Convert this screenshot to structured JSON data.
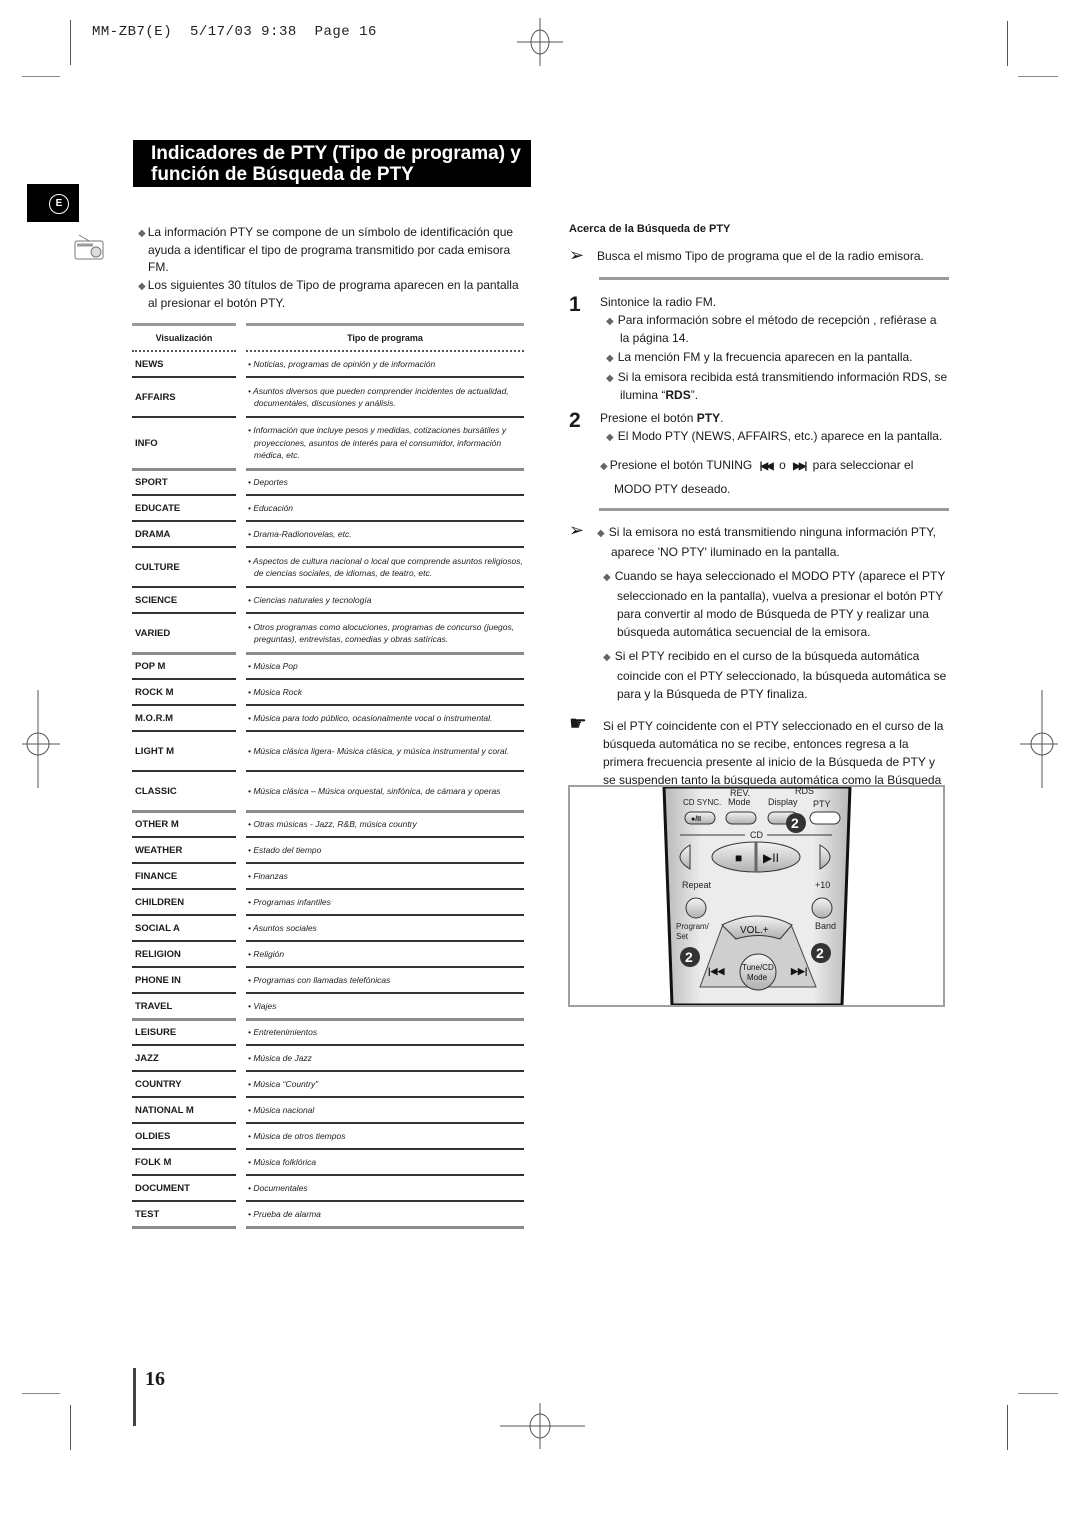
{
  "slug": {
    "code": "MM-ZB7(E)",
    "date": "5/17/03",
    "time": "9:38",
    "page_label": "Page",
    "page": "16"
  },
  "section_title": {
    "line1": "Indicadores de PTY (Tipo de programa) y",
    "line2": "función de Búsqueda de PTY"
  },
  "language_badge": "E",
  "intro": [
    "La información PTY se compone de un símbolo de identificación que ayuda a identificar el tipo de programa transmitido por cada emisora FM.",
    "Los siguientes 30 títulos de Tipo de programa aparecen en la pantalla al presionar el botón PTY."
  ],
  "pty_table": {
    "headers": [
      "Visualización",
      "Tipo de programa"
    ],
    "rows": [
      {
        "code": "NEWS",
        "desc": "• Noticias, programas de opinión y de información"
      },
      {
        "code": "AFFAIRS",
        "desc": "• Asuntos diversos que pueden comprender incidentes de actualidad, documentales, discusiones y análisis."
      },
      {
        "code": "INFO",
        "desc": "• Información que incluye pesos y medidas, cotizaciones bursátiles y proyecciones, asuntos de interés para el consumidor, información médica, etc."
      },
      {
        "code": "SPORT",
        "desc": "• Deportes"
      },
      {
        "code": "EDUCATE",
        "desc": "• Educación"
      },
      {
        "code": "DRAMA",
        "desc": "• Drama-Radionovelas, etc."
      },
      {
        "code": "CULTURE",
        "desc": "• Aspectos de cultura nacional o local que comprende asuntos religiosos, de ciencias sociales, de idiomas, de teatro, etc."
      },
      {
        "code": "SCIENCE",
        "desc": "• Ciencias naturales y tecnología"
      },
      {
        "code": "VARIED",
        "desc": "• Otros programas como alocuciones, programas de concurso (juegos, preguntas), entrevistas, comedias y obras satíricas."
      },
      {
        "code": "POP M",
        "desc": "• Música Pop"
      },
      {
        "code": "ROCK M",
        "desc": "• Música Rock"
      },
      {
        "code": "M.O.R.M",
        "desc": "• Música para todo público, ocasionalmente vocal o instrumental."
      },
      {
        "code": "LIGHT M",
        "desc": "• Música clásica ligera- Música clásica, y música instrumental y coral."
      },
      {
        "code": "CLASSIC",
        "desc": "• Música clásica – Música orquestal, sinfónica, de cámara y operas"
      },
      {
        "code": "OTHER M",
        "desc": "• Otras músicas - Jazz, R&B, música country"
      },
      {
        "code": "WEATHER",
        "desc": "• Estado del tiempo"
      },
      {
        "code": "FINANCE",
        "desc": "• Finanzas"
      },
      {
        "code": "CHILDREN",
        "desc": "• Programas infantiles"
      },
      {
        "code": "SOCIAL  A",
        "desc": "• Asuntos sociales"
      },
      {
        "code": "RELIGION",
        "desc": "• Religión"
      },
      {
        "code": "PHONE IN",
        "desc": "• Programas con llamadas telefónicas"
      },
      {
        "code": "TRAVEL",
        "desc": "• Viajes"
      },
      {
        "code": "LEISURE",
        "desc": "• Entretenimientos"
      },
      {
        "code": "JAZZ",
        "desc": "• Música de Jazz"
      },
      {
        "code": "COUNTRY",
        "desc": "• Música “Country”"
      },
      {
        "code": "NATIONAL M",
        "desc": "• Música nacional"
      },
      {
        "code": "OLDIES",
        "desc": "• Música de otros tiempos"
      },
      {
        "code": "FOLK M",
        "desc": "• Música folklórica"
      },
      {
        "code": "DOCUMENT",
        "desc": "• Documentales"
      },
      {
        "code": "TEST",
        "desc": "• Prueba de alarma"
      }
    ]
  },
  "search": {
    "heading": "Acerca de la Búsqueda de PTY",
    "summary": "Busca el mismo Tipo de programa que el de la radio emisora.",
    "step1": {
      "num": "1",
      "text": "Sintonice la radio FM.",
      "bullets": [
        "Para información sobre el método de recepción , refiérase a la página 14.",
        "La mención FM y la frecuencia aparecen en la pantalla."
      ],
      "rds_prefix": "Si la emisora recibida está transmitiendo información RDS, se ilumina “",
      "rds_bold": "RDS",
      "rds_suffix": "”."
    },
    "step2": {
      "num": "2",
      "text_prefix": "Presione el botón ",
      "text_bold": "PTY",
      "text_suffix": ".",
      "bullet1": "El Modo PTY (NEWS, AFFAIRS, etc.) aparece en la pantalla.",
      "tuning_prefix": "Presione el botón TUNING",
      "tuning_or": "o",
      "tuning_suffix": "para seleccionar el",
      "tuning_line2": "MODO PTY deseado.",
      "prev_glyph": "|◀◀",
      "next_glyph": "▶▶|"
    },
    "notes": [
      "Si la emisora no está transmitiendo ninguna información PTY, aparece 'NO PTY' iluminado en la pantalla.",
      "Cuando se haya seleccionado el MODO PTY (aparece el PTY seleccionado en la pantalla), vuelva a presionar el botón PTY para convertir al modo de Búsqueda de PTY y realizar una búsqueda automática secuencial de la emisora.",
      "Si el PTY recibido en el curso de la búsqueda automática coincide con el PTY seleccionado, la búsqueda automática se para y la Búsqueda de PTY finaliza."
    ],
    "caution": "Si el PTY coincidente con el PTY seleccionado en el curso de la búsqueda automática no se recibe, entonces regresa a la primera frecuencia presente al inicio de la Búsqueda de PTY y se suspenden tanto la búsqueda automática como la Búsqueda de PTY."
  },
  "remote": {
    "cd_sync": "CD SYNC.",
    "rec_glyph": "●/II",
    "rev_mode": [
      "REV.",
      "Mode"
    ],
    "rds_label": "RDS",
    "display": "Display",
    "pty": "PTY",
    "cd_label": "CD",
    "stop_glyph": "■",
    "play_glyph": "▶II",
    "repeat": "Repeat",
    "plus10": "+10",
    "program_set": [
      "Program/",
      "Set"
    ],
    "band": "Band",
    "vol_plus": "VOL.+",
    "tune_mode": [
      "Tune/CD",
      "Mode"
    ],
    "prev_glyph": "|◀◀",
    "next_glyph": "▶▶|",
    "callout": "2"
  },
  "page_number": "16"
}
